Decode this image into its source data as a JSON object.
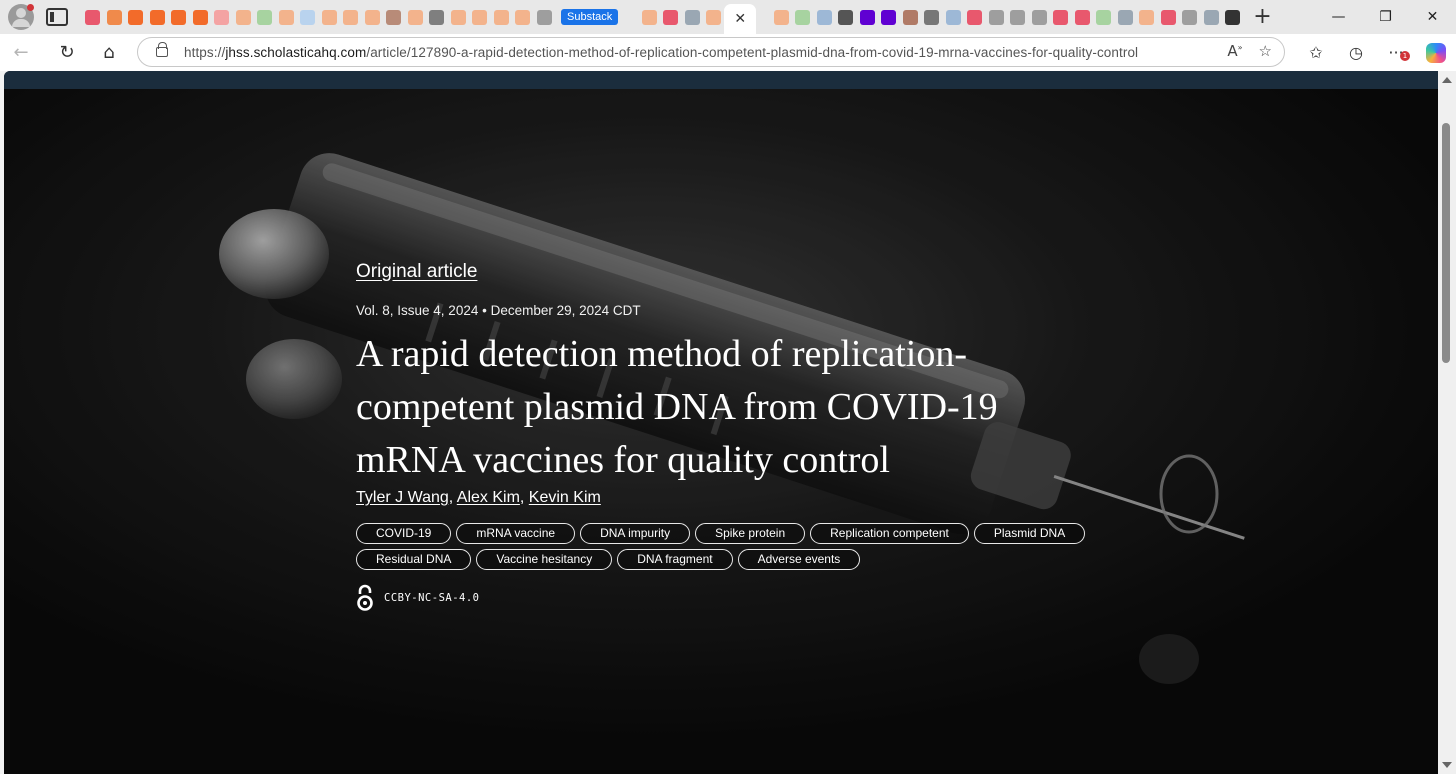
{
  "browser": {
    "active_tab_close": "✕",
    "substack_tab_label": "Substack",
    "url_scheme": "https://",
    "url_host": "jhss.scholasticahq.com",
    "url_path": "/article/127890-a-rapid-detection-method-of-replication-competent-plasmid-dna-from-covid-19-mrna-vaccines-for-quality-control",
    "notification_count": "1",
    "tab_favicon_colors": [
      "#e8586d",
      "#f08a4b",
      "#f26b2a",
      "#f26b2a",
      "#f26b2a",
      "#f26b2a",
      "#f4a3a3",
      "#f3b38c",
      "#a7d3a0",
      "#f3b38c",
      "#b9d3ee",
      "#f3b38c",
      "#f3b38c",
      "#f3b38c",
      "#b88b78",
      "#f3b38c",
      "#7f7f7f",
      "#f3b38c",
      "#f3b38c",
      "#f3b38c",
      "#f3b38c",
      "#9e9e9e",
      "#f3b38c",
      "#e8586d",
      "#9aa7b3",
      "#f3b38c"
    ],
    "tab_favicon_colors_right": [
      "#f3b38c",
      "#a7d3a0",
      "#9db8d6",
      "#555555",
      "#6001d2",
      "#6001d2",
      "#b07a66",
      "#777777",
      "#9db8d6",
      "#e8586d",
      "#9e9e9e",
      "#9e9e9e",
      "#9e9e9e",
      "#e8586d",
      "#e8586d",
      "#a7d3a0",
      "#9aa7b3",
      "#f3b38c",
      "#e8586d",
      "#9e9e9e",
      "#9aa7b3",
      "#333333"
    ]
  },
  "article": {
    "type": "Original article",
    "meta": "Vol. 8, Issue 4, 2024 • December 29, 2024 CDT",
    "title": "A rapid detection method of replication-competent plasmid DNA from COVID-19 mRNA vaccines for quality control",
    "authors": [
      "Tyler J Wang",
      "Alex Kim",
      "Kevin Kim"
    ],
    "author_separator": ", ",
    "tags": [
      "COVID-19",
      "mRNA vaccine",
      "DNA impurity",
      "Spike protein",
      "Replication competent",
      "Plasmid DNA",
      "Residual DNA",
      "Vaccine hesitancy",
      "DNA fragment",
      "Adverse events"
    ],
    "license": "CCBY-NC-SA-4.0"
  },
  "colors": {
    "page_topbar": "#1b2d3d",
    "hero_bg": "#0c0c0c",
    "accent_blue": "#1a73e8"
  }
}
